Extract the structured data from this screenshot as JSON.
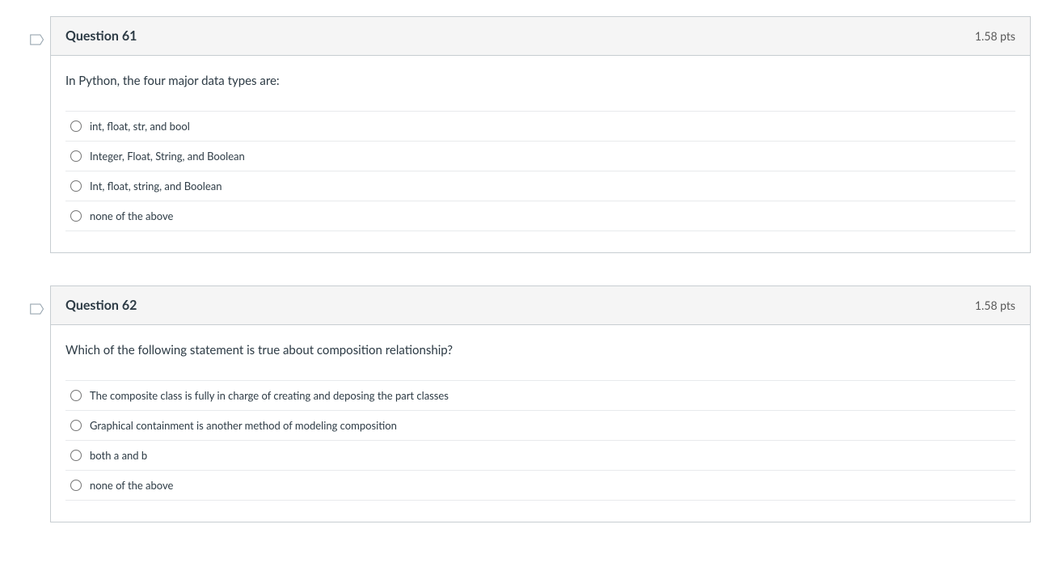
{
  "questions": [
    {
      "title": "Question 61",
      "points": "1.58 pts",
      "prompt": "In Python, the four major data types are:",
      "options": [
        "int, float, str, and bool",
        "Integer, Float, String, and Boolean",
        "Int, float, string, and Boolean",
        "none of the above"
      ]
    },
    {
      "title": "Question 62",
      "points": "1.58 pts",
      "prompt": "Which of the following statement is true about composition relationship?",
      "options": [
        "The composite class is fully in charge of creating and deposing the part classes",
        "Graphical containment is another method of modeling composition",
        "both a and b",
        "none of the above"
      ]
    }
  ]
}
